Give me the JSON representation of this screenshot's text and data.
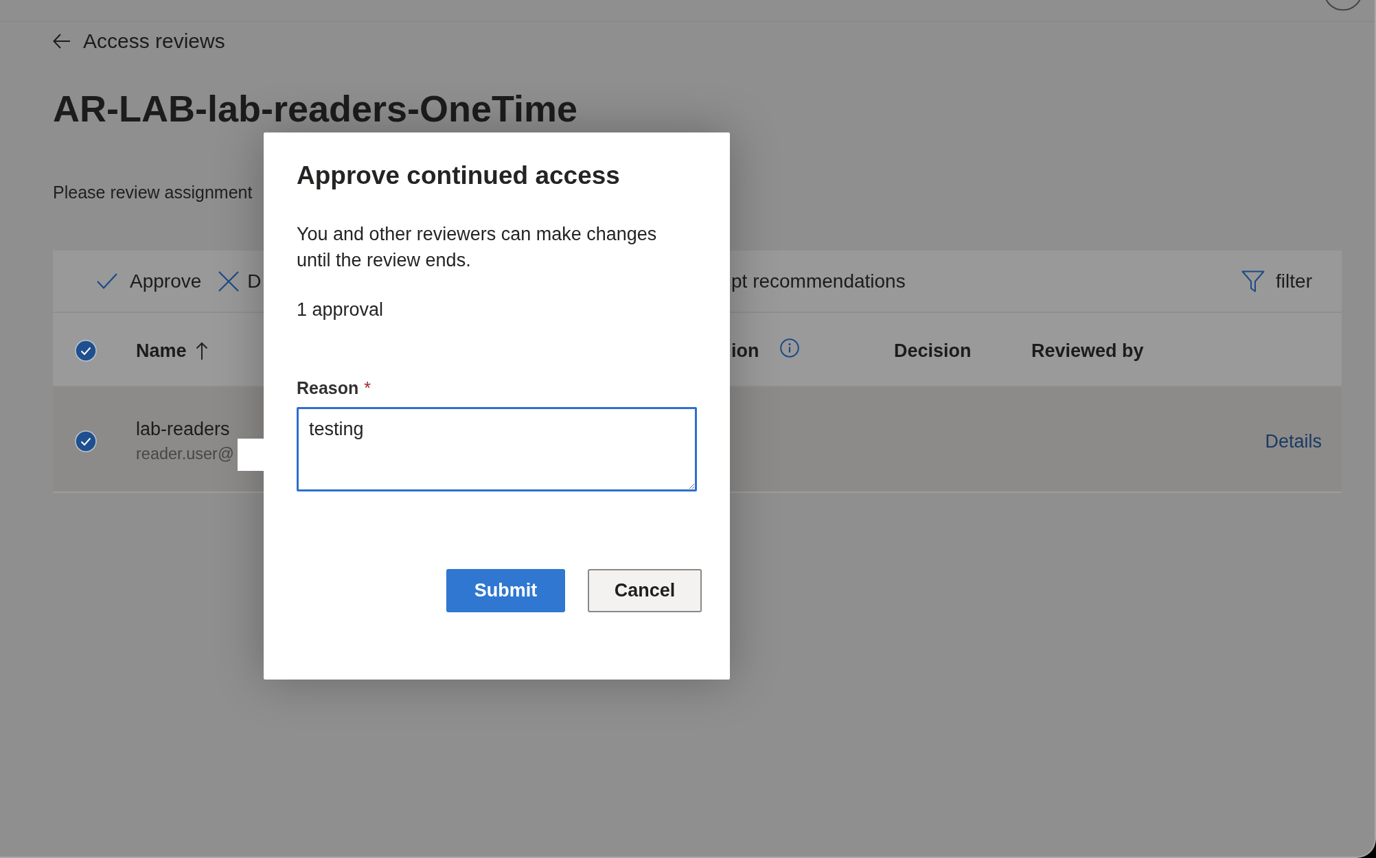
{
  "breadcrumb": {
    "back_label": "Access reviews"
  },
  "page": {
    "title": "AR-LAB-lab-readers-OneTime",
    "description": "Please review assignment"
  },
  "toolbar": {
    "actions": [
      {
        "kind": "approve",
        "label": "Approve"
      },
      {
        "kind": "deny",
        "label": "D"
      },
      {
        "kind": "text",
        "label": "pt recommendations"
      }
    ],
    "filter": {
      "label": "filter"
    }
  },
  "table": {
    "select_all": {
      "checked": true
    },
    "columns": [
      {
        "label": "Name",
        "sorted": true
      },
      {
        "label": "ion",
        "info": true
      },
      {
        "label": "Decision"
      },
      {
        "label": "Reviewed by"
      }
    ],
    "rows": [
      {
        "selected": true,
        "name": "lab-readers",
        "email": "reader.user@",
        "action": "Details"
      }
    ]
  },
  "dialog": {
    "title": "Approve continued access",
    "message": "You and other reviewers can make changes until the review ends.",
    "summary": "1 approval",
    "field": {
      "label": "Reason",
      "required_mark": "*",
      "value": "testing",
      "focused": true
    },
    "buttons": [
      {
        "kind": "primary",
        "label": "Submit"
      },
      {
        "kind": "secondary",
        "label": "Cancel"
      }
    ]
  }
}
